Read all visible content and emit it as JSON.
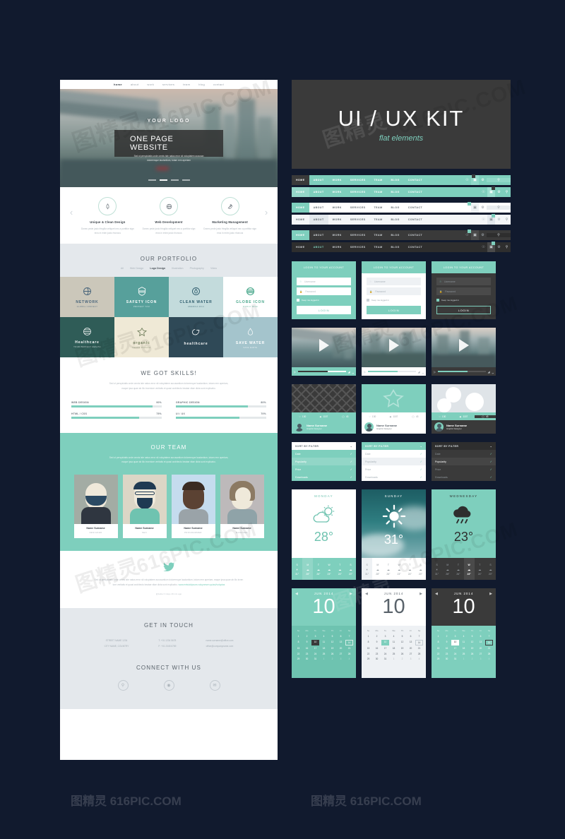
{
  "kit": {
    "title": "UI / UX KIT",
    "subtitle": "flat elements"
  },
  "site": {
    "nav": [
      "home",
      "about",
      "work",
      "services",
      "team",
      "blog",
      "contact"
    ],
    "hero": {
      "logo": "YOUR LOGO",
      "button": "ONE PAGE WEBSITE",
      "sub_line1": "Sed ut perspiciatis unde omnis iste natus error sit voluptatem accusan",
      "sub_line2": "doloremque laudantium, totam rem aperiam"
    },
    "features": [
      {
        "title": "Unique & Clean Design",
        "desc": "Donec pede justo fringilla veliquet nec a porttitor sign eros in enim justo rhoncus"
      },
      {
        "title": "Web Development",
        "desc": "Donec pede justo fringilla veliquet nec a porttitor sign eros in enim justo rhoncus"
      },
      {
        "title": "Marketing Management",
        "desc": "Donec pede justo fringilla veliquet nec a porttitor sign eros in enim justo rhoncus"
      }
    ],
    "portfolio": {
      "heading": "OUR PORTFOLIO",
      "filters": [
        "All",
        "Web Design",
        "Logo Design",
        "Illustration",
        "Photography",
        "Video"
      ],
      "active_filter": "Logo Design",
      "items": [
        {
          "name": "NETWORK",
          "sub": "GLOBAL CONNECT",
          "bg": "#cbc7ba",
          "fg": "#46637a"
        },
        {
          "name": "SAFETY ICON",
          "sub": "PROTECT YOU",
          "bg": "#57a09b",
          "fg": "#ffffff"
        },
        {
          "name": "CLEAN WATER",
          "sub": "AMERICA 2014",
          "bg": "#c3dbdc",
          "fg": "#2f5d6e"
        },
        {
          "name": "GLOBE ICON",
          "sub": "WORLD WIDE",
          "bg": "#ffffff",
          "fg": "#4aa88c"
        },
        {
          "name": "Healthcare",
          "sub": "YOUR PERFECT HEALTH",
          "bg": "#2f5c57",
          "fg": "#ffffff"
        },
        {
          "name": "organic",
          "sub": "Gamble Products",
          "bg": "#efe9d6",
          "fg": "#6d7b58"
        },
        {
          "name": "healthcare",
          "sub": "",
          "bg": "#2f4957",
          "fg": "#ffffff"
        },
        {
          "name": "SAVE WATER",
          "sub": "SAVE EARTH",
          "bg": "#a4c4cc",
          "fg": "#ffffff"
        }
      ]
    },
    "skills": {
      "heading": "WE GOT SKILLS!",
      "desc_line1": "Sed ut perspiciatis unde omnis iste natus error sit voluptatem accusantium doloremque laudantium, totam rem aperiam,",
      "desc_line2": "eaque ipsa quae ab illo inventore veritatis et quasi architecto beatae vitae dicta sunt explicabo.",
      "bars": [
        {
          "label": "WEB DESIGN",
          "value": 90,
          "value_label": "90%"
        },
        {
          "label": "GRAPHIC DESIGN",
          "value": 80,
          "value_label": "80%"
        },
        {
          "label": "HTML / CSS",
          "value": 75,
          "value_label": "75%"
        },
        {
          "label": "UI / UX",
          "value": 70,
          "value_label": "70%"
        }
      ]
    },
    "team": {
      "heading": "OUR TEAM",
      "desc_line1": "Sed ut perspiciatis unde omnis iste natus error sit voluptatem accusantium doloremque laudantium, totam rem aperiam,",
      "desc_line2": "eaque ipsa quae ab illo inventore veritatis et quasi architecto beatae vitae dicta sunt explicabo.",
      "members": [
        {
          "name": "Name Surname",
          "role": "DESIGNER"
        },
        {
          "name": "Name Surname",
          "role": "SEO"
        },
        {
          "name": "Name Surname",
          "role": "PROGRAMMER"
        },
        {
          "name": "Name Surname",
          "role": "MANAGER"
        }
      ]
    },
    "tweet": {
      "line1": "Sed ut perspiciatis unde omnis iste natus error sit voluptatem accusantium doloremque laudantium, totam rem aperiam, eaque ipsa quae ab illo inven",
      "line2": "tore veritatis et quasi architecto beatae vitae dicta sunt explicabo.",
      "link": "www.entwicklpsum.volupnesen.quissi/voluptas",
      "meta": "@twitter 3 days 49 min ago"
    },
    "contact": {
      "heading": "GET IN TOUCH",
      "col1_line1": "STREET NAME 1234",
      "col1_line2": "CITY NAME, COUNTRY",
      "col2_line1": "T: +01 1234 5678",
      "col2_line2": "F: +01 2345 6789",
      "col3_line1": "name.surname@office.com",
      "col3_line2": "office@companyname.com",
      "connect_heading": "CONNECT WITH US",
      "socials": [
        "search-icon",
        "camera-icon",
        "mail-icon"
      ]
    }
  },
  "navbars": {
    "items": [
      "HOME",
      "ABOUT",
      "WORK",
      "SERVICES",
      "TEAM",
      "BLOG",
      "CONTACT"
    ],
    "icons": [
      "globe-icon",
      "photo-icon",
      "gear-icon"
    ],
    "search_icon": "search-icon",
    "variants": [
      "teal-dark-home",
      "teal-light-home",
      "white-teal-home",
      "light-grey",
      "dark-teal-home",
      "dark-plain"
    ]
  },
  "login": {
    "heading": "LOGIN TO YOUR ACCOUNT",
    "username_placeholder": "Username",
    "password_placeholder": "Password",
    "remember_label": "Keep me logged in",
    "submit_label": "LOGIN",
    "user_icon": "user-icon",
    "lock_icon": "lock-icon"
  },
  "video": {
    "play_icon": "play-icon",
    "progress": 62,
    "volume_icon": "volume-icon",
    "fullscreen_icon": "fullscreen-icon",
    "small_play_icon": "play-small-icon"
  },
  "profile": {
    "name": "Name Surname",
    "role": "Graphic Designer",
    "stats": [
      {
        "icon": "heart-icon",
        "value": "130"
      },
      {
        "icon": "eye-icon",
        "value": "1157"
      },
      {
        "icon": "comment-icon",
        "value": "43"
      }
    ]
  },
  "filter": {
    "heading": "SORT BY FILTER",
    "chevron_icon": "chevron-down-icon",
    "check_icon": "check-icon",
    "options": [
      "Date",
      "Popularity",
      "Price",
      "Downloads"
    ],
    "selected": "Popularity"
  },
  "weather": {
    "cards": [
      {
        "day": "MONDAY",
        "temp": "28",
        "degree": "°",
        "icon": "sun-cloud-icon",
        "active_index": 1
      },
      {
        "day": "SUNDAY",
        "temp": "31",
        "degree": "°",
        "icon": "sun-icon",
        "active_index": 0
      },
      {
        "day": "WEDNESDAY",
        "temp": "23",
        "degree": "°",
        "icon": "rain-cloud-icon",
        "active_index": 3
      }
    ],
    "days": [
      "S",
      "M",
      "T",
      "W",
      "T",
      "S"
    ],
    "temps": [
      "31°",
      "28°",
      "26°",
      "23°",
      "24°",
      "20°"
    ],
    "strip_icons": [
      "sun-icon",
      "cloud-icon",
      "cloud-icon",
      "cloud-icon",
      "cloud-icon",
      "cloud-icon"
    ]
  },
  "calendar": {
    "month": "JUN 2014",
    "big_day": "10",
    "prev_icon": "chevron-left-icon",
    "next_icon": "chevron-right-icon",
    "weekdays": [
      "Su",
      "Mo",
      "Tu",
      "We",
      "Th",
      "Fr",
      "Sa"
    ],
    "weeks": [
      [
        "1",
        "2",
        "3",
        "4",
        "5",
        "6",
        "7"
      ],
      [
        "8",
        "9",
        "10",
        "11",
        "12",
        "13",
        "14"
      ],
      [
        "15",
        "16",
        "17",
        "18",
        "19",
        "20",
        "21"
      ],
      [
        "22",
        "23",
        "24",
        "25",
        "26",
        "27",
        "28"
      ],
      [
        "29",
        "30",
        "31",
        "1",
        "2",
        "3",
        "4"
      ]
    ],
    "selected_day": "10",
    "outlined_day": "14",
    "trailing_from": "1"
  },
  "watermarks": {
    "cn": "图精灵",
    "site": "616PIC.COM",
    "bottom": "图精灵 616PIC.COM"
  },
  "colors": {
    "teal": "#7ecfbd",
    "dark": "#3a3a3a",
    "bg": "#111a2e",
    "light": "#e4e8ec"
  }
}
